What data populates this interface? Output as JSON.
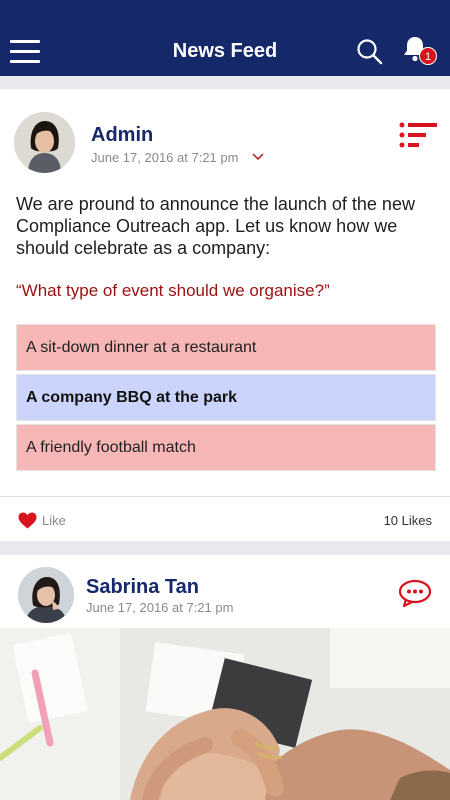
{
  "header": {
    "title": "News Feed",
    "notification_count": "1",
    "bg_color": "#14286a"
  },
  "posts": [
    {
      "author": "Admin",
      "timestamp": "June 17, 2016 at 7:21 pm",
      "type_icon": "poll-icon",
      "body": "We are pround to announce the launch of the new Compliance Outreach app. Let us know how we should celebrate as a company:",
      "poll": {
        "question": "“What type of event should we organise?”",
        "options": [
          {
            "label": "A sit-down dinner at a restaurant",
            "selected": false
          },
          {
            "label": "A company BBQ at the park",
            "selected": true
          },
          {
            "label": "A friendly football match",
            "selected": false
          }
        ]
      },
      "like_label": "Like",
      "likes_count": "10 Likes"
    },
    {
      "author": "Sabrina Tan",
      "timestamp": "June 17, 2016 at 7:21 pm",
      "type_icon": "comment-icon"
    }
  ],
  "colors": {
    "accent_red": "#d7141e",
    "option_default": "#f7b7b7",
    "option_selected": "#cbd4fb",
    "question": "#9c1010"
  }
}
